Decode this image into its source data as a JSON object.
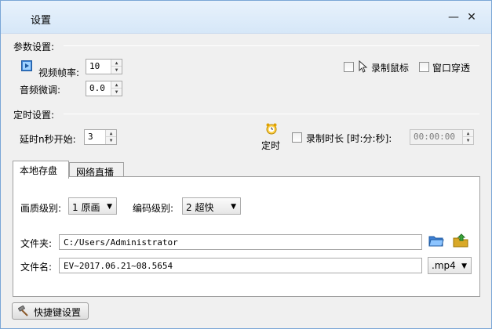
{
  "window": {
    "title": "设置",
    "minimize": "—",
    "close": "✕"
  },
  "params": {
    "heading": "参数设置:",
    "fps_label": "视频帧率:",
    "fps_value": "10",
    "audio_label": "音频微调:",
    "audio_value": "0.0",
    "record_mouse_label": "录制鼠标",
    "record_mouse_checked": false,
    "window_through_label": "窗口穿透",
    "window_through_checked": false
  },
  "timer": {
    "heading": "定时设置:",
    "delay_label": "延时n秒开始:",
    "delay_value": "3",
    "timer_label": "定时",
    "duration_label": "录制时长 [时:分:秒]:",
    "duration_checked": false,
    "duration_value": "00:00:00"
  },
  "tabs": [
    {
      "label": "本地存盘",
      "active": true
    },
    {
      "label": "网络直播",
      "active": false
    }
  ],
  "local": {
    "quality_label": "画质级别:",
    "quality_value": "1 原画",
    "encode_label": "编码级别:",
    "encode_value": "2 超快",
    "folder_label": "文件夹:",
    "folder_value": "C:/Users/Administrator",
    "filename_label": "文件名:",
    "filename_value": "EV~2017.06.21~08.5654",
    "ext_value": ".mp4"
  },
  "bottom": {
    "hotkey_label": "快捷键设置"
  },
  "colors": {
    "titlebar": "#d6e7f8",
    "panel": "#f0f0f0",
    "border": "#7aa6d6"
  }
}
